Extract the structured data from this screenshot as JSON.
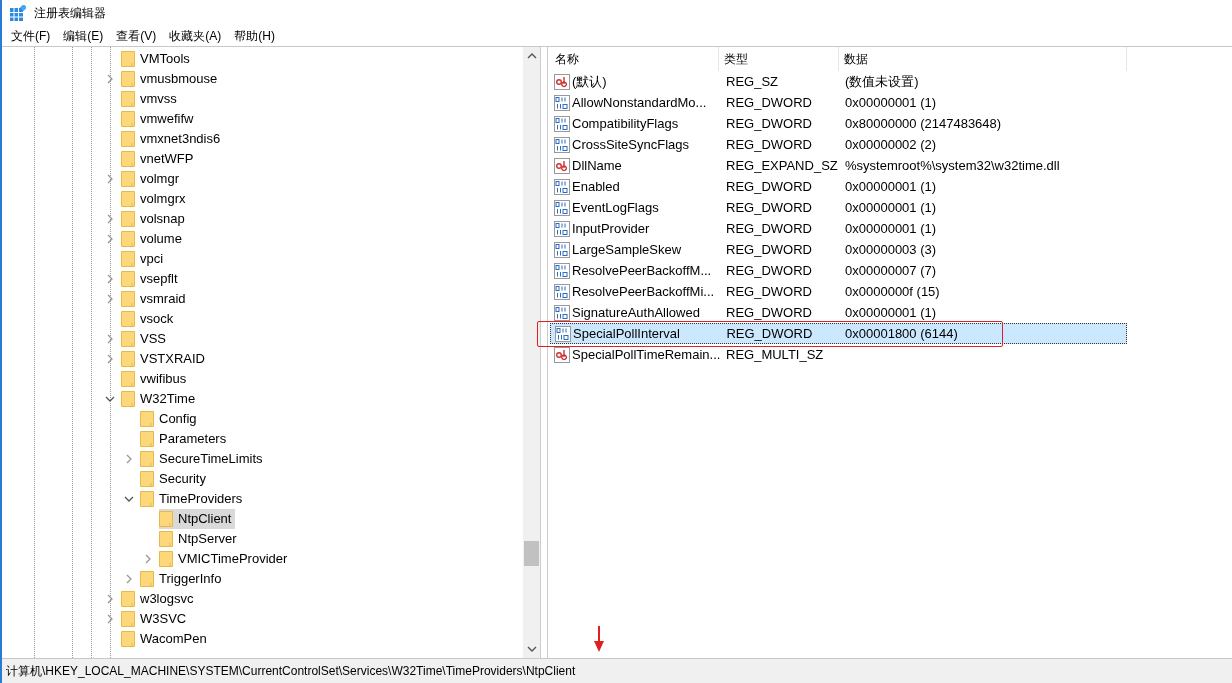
{
  "window": {
    "title": "注册表编辑器"
  },
  "menu": [
    "文件(F)",
    "编辑(E)",
    "查看(V)",
    "收藏夹(A)",
    "帮助(H)"
  ],
  "tree": [
    {
      "label": "VMTools",
      "has_children": false,
      "selected": false
    },
    {
      "label": "vmusbmouse",
      "has_children": true,
      "expanded": false,
      "selected": false
    },
    {
      "label": "vmvss",
      "has_children": false,
      "selected": false
    },
    {
      "label": "vmwefifw",
      "has_children": false,
      "selected": false
    },
    {
      "label": "vmxnet3ndis6",
      "has_children": false,
      "selected": false
    },
    {
      "label": "vnetWFP",
      "has_children": false,
      "selected": false
    },
    {
      "label": "volmgr",
      "has_children": true,
      "expanded": false,
      "selected": false
    },
    {
      "label": "volmgrx",
      "has_children": false,
      "selected": false
    },
    {
      "label": "volsnap",
      "has_children": true,
      "expanded": false,
      "selected": false
    },
    {
      "label": "volume",
      "has_children": true,
      "expanded": false,
      "selected": false
    },
    {
      "label": "vpci",
      "has_children": false,
      "selected": false
    },
    {
      "label": "vsepflt",
      "has_children": true,
      "expanded": false,
      "selected": false
    },
    {
      "label": "vsmraid",
      "has_children": true,
      "expanded": false,
      "selected": false
    },
    {
      "label": "vsock",
      "has_children": false,
      "selected": false
    },
    {
      "label": "VSS",
      "has_children": true,
      "expanded": false,
      "selected": false
    },
    {
      "label": "VSTXRAID",
      "has_children": true,
      "expanded": false,
      "selected": false
    },
    {
      "label": "vwifibus",
      "has_children": false,
      "selected": false
    },
    {
      "label": "W32Time",
      "has_children": true,
      "expanded": true,
      "selected": false,
      "children": [
        {
          "label": "Config",
          "has_children": false,
          "selected": false
        },
        {
          "label": "Parameters",
          "has_children": false,
          "selected": false
        },
        {
          "label": "SecureTimeLimits",
          "has_children": true,
          "expanded": false,
          "selected": false
        },
        {
          "label": "Security",
          "has_children": false,
          "selected": false
        },
        {
          "label": "TimeProviders",
          "has_children": true,
          "expanded": true,
          "selected": false,
          "children": [
            {
              "label": "NtpClient",
              "has_children": false,
              "selected": true
            },
            {
              "label": "NtpServer",
              "has_children": false,
              "selected": false
            },
            {
              "label": "VMICTimeProvider",
              "has_children": true,
              "expanded": false,
              "selected": false
            }
          ]
        },
        {
          "label": "TriggerInfo",
          "has_children": true,
          "expanded": false,
          "selected": false
        }
      ]
    },
    {
      "label": "w3logsvc",
      "has_children": true,
      "expanded": false,
      "selected": false
    },
    {
      "label": "W3SVC",
      "has_children": true,
      "expanded": false,
      "selected": false
    },
    {
      "label": "WacomPen",
      "has_children": false,
      "selected": false
    }
  ],
  "table": {
    "columns": [
      "名称",
      "类型",
      "数据"
    ],
    "rows": [
      {
        "kind": "string",
        "name": "(默认)",
        "type": "REG_SZ",
        "data": "(数值未设置)",
        "selected": false,
        "marked": false
      },
      {
        "kind": "dword",
        "name": "AllowNonstandardMo...",
        "type": "REG_DWORD",
        "data": "0x00000001 (1)",
        "selected": false,
        "marked": false
      },
      {
        "kind": "dword",
        "name": "CompatibilityFlags",
        "type": "REG_DWORD",
        "data": "0x80000000 (2147483648)",
        "selected": false,
        "marked": false
      },
      {
        "kind": "dword",
        "name": "CrossSiteSyncFlags",
        "type": "REG_DWORD",
        "data": "0x00000002 (2)",
        "selected": false,
        "marked": false
      },
      {
        "kind": "string",
        "name": "DllName",
        "type": "REG_EXPAND_SZ",
        "data": "%systemroot%\\system32\\w32time.dll",
        "selected": false,
        "marked": false
      },
      {
        "kind": "dword",
        "name": "Enabled",
        "type": "REG_DWORD",
        "data": "0x00000001 (1)",
        "selected": false,
        "marked": false
      },
      {
        "kind": "dword",
        "name": "EventLogFlags",
        "type": "REG_DWORD",
        "data": "0x00000001 (1)",
        "selected": false,
        "marked": false
      },
      {
        "kind": "dword",
        "name": "InputProvider",
        "type": "REG_DWORD",
        "data": "0x00000001 (1)",
        "selected": false,
        "marked": false
      },
      {
        "kind": "dword",
        "name": "LargeSampleSkew",
        "type": "REG_DWORD",
        "data": "0x00000003 (3)",
        "selected": false,
        "marked": false
      },
      {
        "kind": "dword",
        "name": "ResolvePeerBackoffM...",
        "type": "REG_DWORD",
        "data": "0x00000007 (7)",
        "selected": false,
        "marked": false
      },
      {
        "kind": "dword",
        "name": "ResolvePeerBackoffMi...",
        "type": "REG_DWORD",
        "data": "0x0000000f (15)",
        "selected": false,
        "marked": false
      },
      {
        "kind": "dword",
        "name": "SignatureAuthAllowed",
        "type": "REG_DWORD",
        "data": "0x00000001 (1)",
        "selected": false,
        "marked": false
      },
      {
        "kind": "dword",
        "name": "SpecialPollInterval",
        "type": "REG_DWORD",
        "data": "0x00001800 (6144)",
        "selected": true,
        "marked": true
      },
      {
        "kind": "string",
        "name": "SpecialPollTimeRemain...",
        "type": "REG_MULTI_SZ",
        "selected": false,
        "marked": false
      }
    ]
  },
  "status_bar": {
    "path": "计算机\\HKEY_LOCAL_MACHINE\\SYSTEM\\CurrentControlSet\\Services\\W32Time\\TimeProviders\\NtpClient",
    "arrow_marker": true
  }
}
